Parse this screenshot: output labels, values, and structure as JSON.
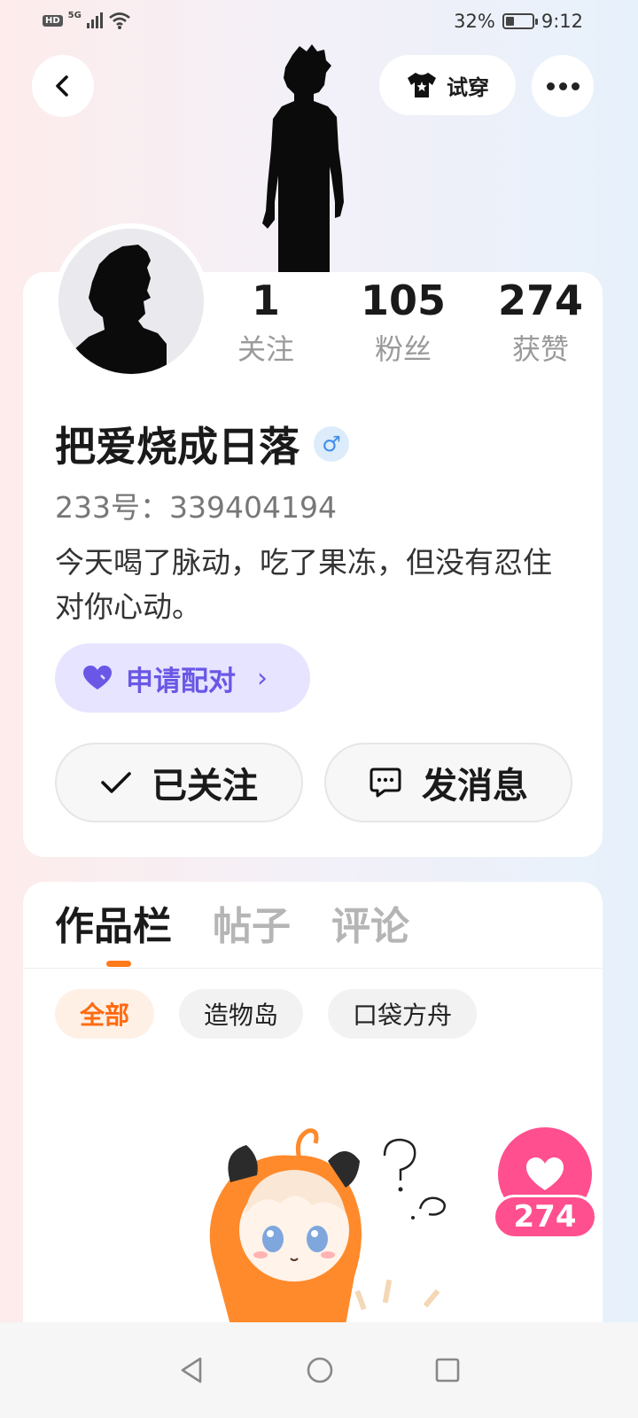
{
  "status_bar": {
    "hd": "HD",
    "network": "5G",
    "battery_pct": "32%",
    "battery_level": 0.32,
    "time": "9:12"
  },
  "header": {
    "tryon_label": "试穿"
  },
  "profile": {
    "stats": [
      {
        "value": "1",
        "label": "关注"
      },
      {
        "value": "105",
        "label": "粉丝"
      },
      {
        "value": "274",
        "label": "获赞"
      }
    ],
    "nickname": "把爱烧成日落",
    "gender_symbol": "♂",
    "uid": "233号：339404194",
    "bio": "今天喝了脉动，吃了果冻，但没有忍住对你心动。",
    "pair_label": "申请配对",
    "follow_label": "已关注",
    "message_label": "发消息"
  },
  "works": {
    "tabs": [
      "作品栏",
      "帖子",
      "评论"
    ],
    "active_tab": 0,
    "filters": [
      "全部",
      "造物岛",
      "口袋方舟"
    ],
    "active_filter": 0
  },
  "like_fab": {
    "count": "274"
  },
  "colors": {
    "accent_orange": "#ff7a1a",
    "pair_purple": "#6a57e6",
    "like_pink": "#ff4f8e"
  },
  "icons": [
    "back-icon",
    "tshirt-icon",
    "more-icon",
    "gender-male-icon",
    "heart-icon",
    "check-icon",
    "message-icon",
    "nav-back-icon",
    "nav-home-icon",
    "nav-recents-icon"
  ]
}
